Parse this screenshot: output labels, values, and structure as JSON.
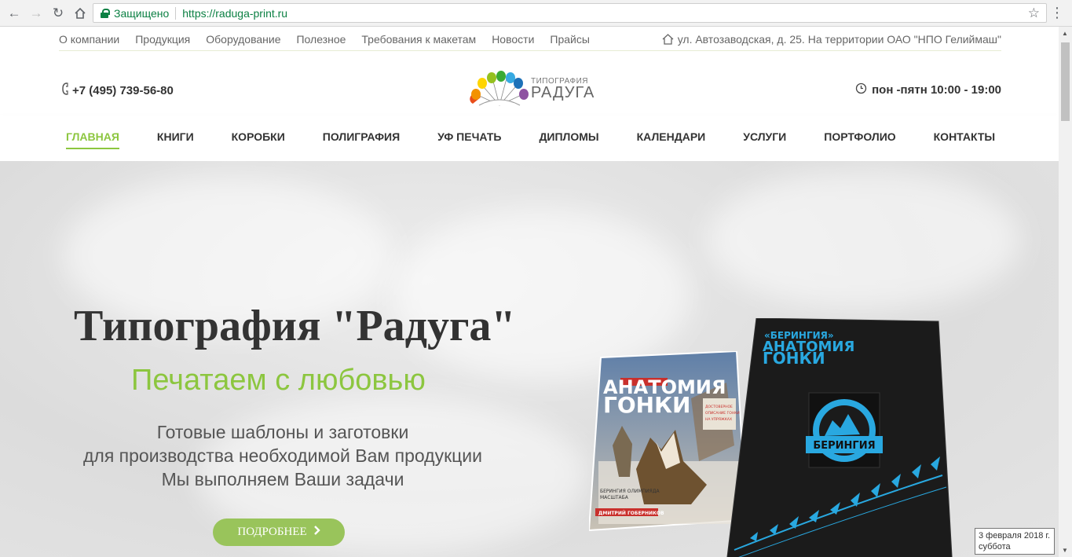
{
  "browser": {
    "secure_label": "Защищено",
    "url": "https://raduga-print.ru"
  },
  "topbar": {
    "links": [
      "О компании",
      "Продукция",
      "Оборудование",
      "Полезное",
      "Требования к макетам",
      "Новости",
      "Прайсы"
    ],
    "address": "ул. Автозаводская, д. 25. На территории ОАО \"НПО Гелиймаш\""
  },
  "header": {
    "phone": "+7 (495) 739-56-80",
    "hours": "пон -пятн 10:00 - 19:00",
    "logo_sub": "ТИПОГРАФИЯ",
    "logo_main": "РАДУГА"
  },
  "nav": {
    "items": [
      "ГЛАВНАЯ",
      "КНИГИ",
      "КОРОБКИ",
      "ПОЛИГРАФИЯ",
      "УФ ПЕЧАТЬ",
      "ДИПЛОМЫ",
      "КАЛЕНДАРИ",
      "УСЛУГИ",
      "ПОРТФОЛИО",
      "КОНТАКТЫ"
    ],
    "active": "ГЛАВНАЯ"
  },
  "hero": {
    "title": "Типография \"Радуга\"",
    "slogan": "Печатаем с любовью",
    "lines": [
      "Готовые шаблоны и заготовки",
      "для производства необходимой Вам продукции",
      "Мы выполняем Ваши задачи"
    ],
    "button": "ПОДРОБНЕЕ"
  },
  "books": {
    "small_title": "АНАТОМИЯ ГОНКИ",
    "small_badge": "ДОСТОВЕРНОЕ ОПИСАНИЕ ГОНКИ НА СОБАЧЬИХ УПРЯЖКАХ",
    "small_author": "ДМИТРИЙ ГОБЕРНИКОВ",
    "small_caption": "БЕРИНГИЯ ОЛИМПИЯДА МАСШТАБА",
    "big_sub": "«БЕРИНГИЯ»",
    "big_title": "АНАТОМИЯ ГОНКИ",
    "seal": "БЕРИНГИЯ"
  },
  "tooltip": {
    "date": "3 февраля 2018 г.",
    "day": "суббота"
  },
  "colors": {
    "accent": "#8cc63f",
    "button": "#99c45b",
    "secure": "#0b8043",
    "book_blue": "#29a8e0"
  }
}
